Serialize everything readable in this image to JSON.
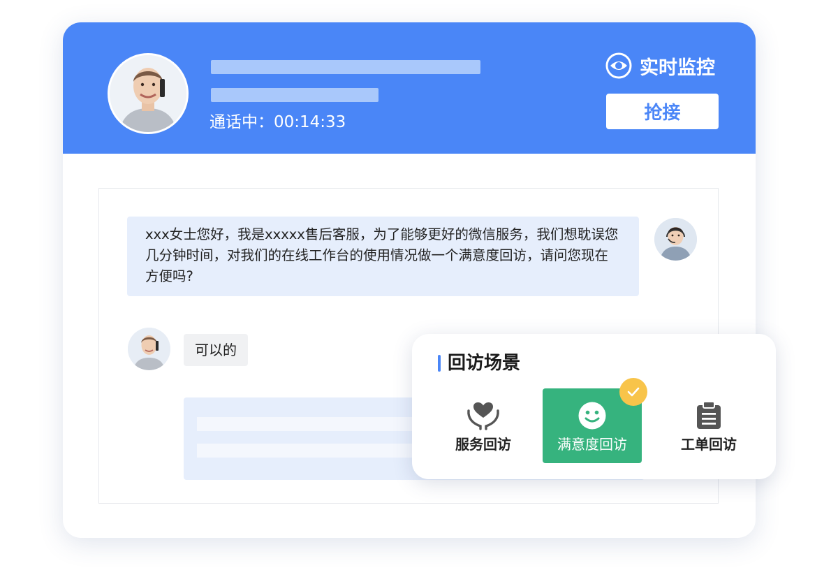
{
  "header": {
    "call_status_label": "通话中：",
    "call_duration": "00:14:33",
    "monitor_label": "实时监控",
    "monitor_icon": "eye-icon",
    "grab_button_label": "抢接"
  },
  "chat": {
    "agent_message": "xxx女士您好，我是xxxxx售后客服，为了能够更好的微信服务，我们想耽误您几分钟时间，对我们的在线工作台的使用情况做一个满意度回访，请问您现在方便吗?",
    "customer_message": "可以的"
  },
  "scene_panel": {
    "title": "回访场景",
    "options": [
      {
        "label": "服务回访",
        "icon": "heart-hands-icon",
        "selected": false
      },
      {
        "label": "满意度回访",
        "icon": "smiley-icon",
        "selected": true
      },
      {
        "label": "工单回访",
        "icon": "clipboard-icon",
        "selected": false
      }
    ]
  },
  "colors": {
    "primary": "#4a86f7",
    "selected": "#36b37e",
    "badge": "#f8c44a"
  }
}
